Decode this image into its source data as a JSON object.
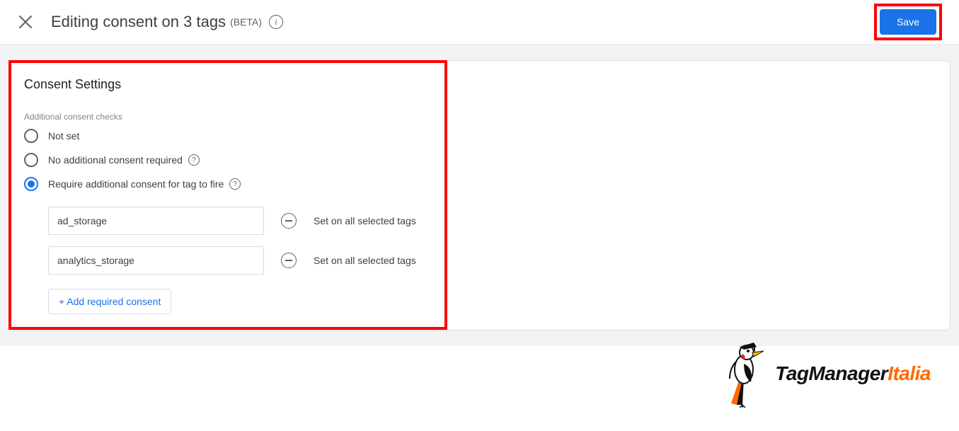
{
  "header": {
    "title": "Editing consent on 3 tags",
    "beta_label": "(BETA)",
    "save_label": "Save"
  },
  "panel": {
    "title": "Consent Settings",
    "subhead": "Additional consent checks",
    "radios": {
      "not_set": "Not set",
      "no_additional": "No additional consent required",
      "require_additional": "Require additional consent for tag to fire"
    },
    "consents": [
      {
        "value": "ad_storage",
        "note": "Set on all selected tags"
      },
      {
        "value": "analytics_storage",
        "note": "Set on all selected tags"
      }
    ],
    "add_button": "+ Add required consent"
  },
  "watermark": {
    "text_a": "TagManager",
    "text_b": "Italia"
  }
}
